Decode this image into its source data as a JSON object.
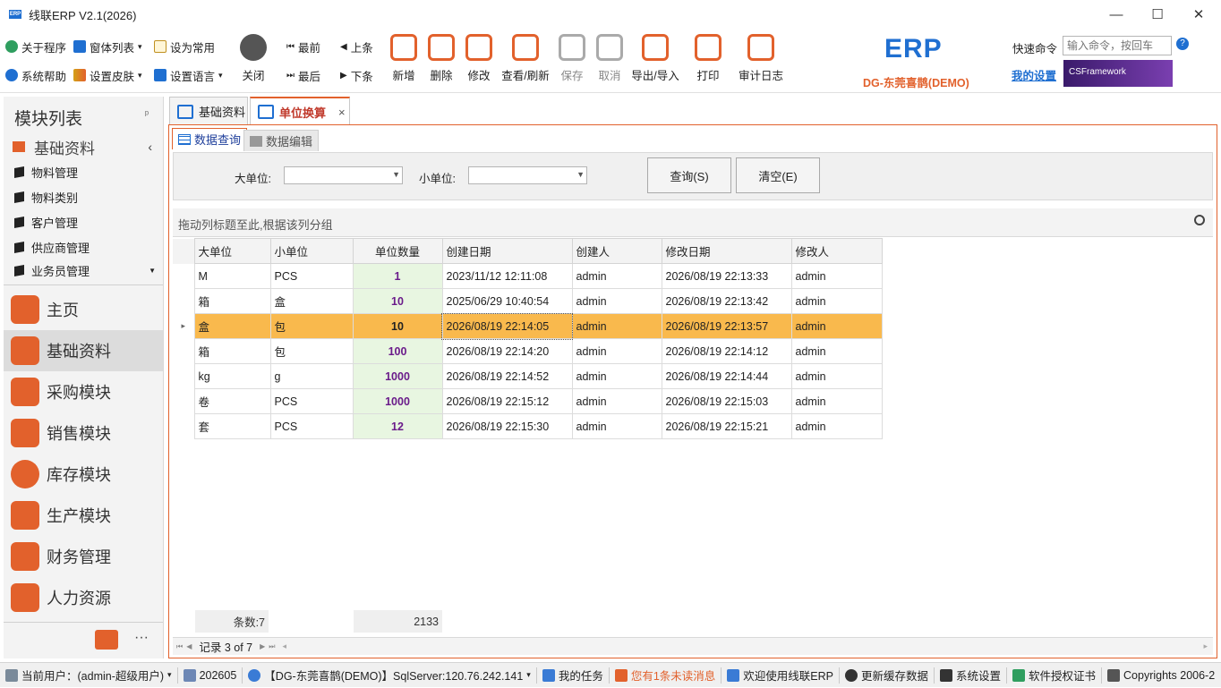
{
  "window": {
    "title": "线联ERP V2.1(2026)",
    "logo_text": "ERP"
  },
  "ribbon": {
    "small": [
      {
        "label": "关于程序",
        "icon": "info-icon"
      },
      {
        "label": "窗体列表",
        "icon": "windows-icon"
      },
      {
        "label": "设为常用",
        "icon": "clipboard-icon"
      },
      {
        "label": "系统帮助",
        "icon": "help-icon"
      },
      {
        "label": "设置皮肤",
        "icon": "palette-icon"
      },
      {
        "label": "设置语言",
        "icon": "language-icon"
      }
    ],
    "close": "关闭",
    "first": "最前",
    "prev": "上条",
    "last": "最后",
    "next": "下条",
    "add": "新增",
    "delete": "删除",
    "edit": "修改",
    "view": "查看/刷新",
    "save": "保存",
    "cancel": "取消",
    "export": "导出/导入",
    "print": "打印",
    "audit": "审计日志",
    "brand": "DG-东莞喜鹊(DEMO)",
    "brand_logo": "ERP",
    "quick_cmd": "快速命令",
    "cmd_placeholder": "输入命令，按回车",
    "my_settings": "我的设置",
    "banner": "CSFramework"
  },
  "sidebar": {
    "title": "模块列表",
    "pin": "ᵖ",
    "section": "基础资料",
    "items": [
      "物料管理",
      "物料类别",
      "客户管理",
      "供应商管理",
      "业务员管理"
    ],
    "modules": [
      "主页",
      "基础资料",
      "采购模块",
      "销售模块",
      "库存模块",
      "生产模块",
      "财务管理",
      "人力资源"
    ],
    "more": "···"
  },
  "tabs": [
    {
      "label": "基础资料"
    },
    {
      "label": "单位换算",
      "close": "×"
    }
  ],
  "subtabs": [
    "数据查询",
    "数据编辑"
  ],
  "filter": {
    "big_unit_label": "大单位:",
    "small_unit_label": "小单位:",
    "query": "查询(S)",
    "clear": "清空(E)"
  },
  "group_hint": "拖动列标题至此,根据该列分组",
  "grid": {
    "columns": [
      "大单位",
      "小单位",
      "单位数量",
      "创建日期",
      "创建人",
      "修改日期",
      "修改人"
    ],
    "rows": [
      [
        "M",
        "PCS",
        "1",
        "2023/11/12 12:11:08",
        "admin",
        "2026/08/19 22:13:33",
        "admin"
      ],
      [
        "箱",
        "盒",
        "10",
        "2025/06/29 10:40:54",
        "admin",
        "2026/08/19 22:13:42",
        "admin"
      ],
      [
        "盒",
        "包",
        "10",
        "2026/08/19 22:14:05",
        "admin",
        "2026/08/19 22:13:57",
        "admin"
      ],
      [
        "箱",
        "包",
        "100",
        "2026/08/19 22:14:20",
        "admin",
        "2026/08/19 22:14:12",
        "admin"
      ],
      [
        "kg",
        "g",
        "1000",
        "2026/08/19 22:14:52",
        "admin",
        "2026/08/19 22:14:44",
        "admin"
      ],
      [
        "卷",
        "PCS",
        "1000",
        "2026/08/19 22:15:12",
        "admin",
        "2026/08/19 22:15:03",
        "admin"
      ],
      [
        "套",
        "PCS",
        "12",
        "2026/08/19 22:15:30",
        "admin",
        "2026/08/19 22:15:21",
        "admin"
      ]
    ],
    "selected_row": 2,
    "footer_count": "条数:7",
    "footer_sum": "2133"
  },
  "nav": {
    "record": "记录 3 of 7"
  },
  "status": {
    "user": "当前用户：(admin-超级用户)",
    "period": "202605",
    "db": "【DG-东莞喜鹊(DEMO)】SqlServer:120.76.242.141",
    "tasks": "我的任务",
    "messages": "您有1条未读消息",
    "welcome": "欢迎使用线联ERP",
    "refresh_cache": "更新缓存数据",
    "settings": "系统设置",
    "license": "软件授权证书",
    "copyright": "Copyrights 2006-2"
  },
  "colors": {
    "accent": "#e2612c",
    "selected": "#f9b94d",
    "qty_bg": "#e8f6e1",
    "qty_text": "#6a1b8a",
    "link": "#1f6fd1"
  }
}
